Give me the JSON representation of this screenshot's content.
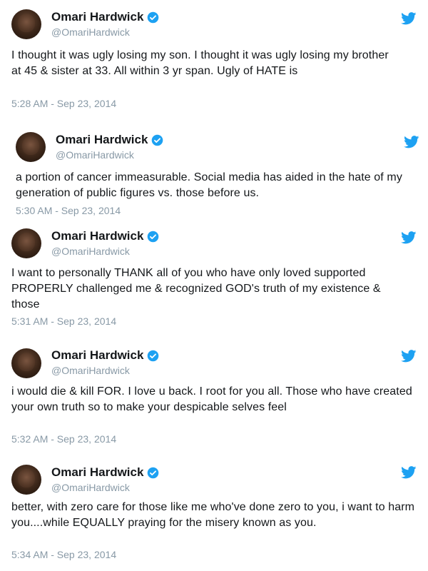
{
  "colors": {
    "twitter_blue": "#1da1f2",
    "text": "#14171a",
    "muted": "#8899a6"
  },
  "tweets": [
    {
      "name": "Omari Hardwick",
      "handle": "@OmariHardwick",
      "text": "I thought it was ugly losing my son. I thought it was ugly losing my brother at 45 & sister at 33. All within 3 yr span. Ugly of HATE is",
      "timestamp": "5:28 AM - Sep 23, 2014",
      "icons": [
        "avatar",
        "verified-badge-icon",
        "twitter-bird-icon"
      ]
    },
    {
      "name": "Omari Hardwick",
      "handle": "@OmariHardwick",
      "text": "a portion of cancer immeasurable. Social media has aided in the hate of my generation of public figures vs. those before us.",
      "timestamp": "5:30 AM - Sep 23, 2014",
      "icons": [
        "avatar",
        "verified-badge-icon",
        "twitter-bird-icon"
      ]
    },
    {
      "name": "Omari Hardwick",
      "handle": "@OmariHardwick",
      "text": "I want to personally THANK all of you who have only loved supported PROPERLY challenged me & recognized GOD's truth of my existence & those",
      "timestamp": "5:31 AM - Sep 23, 2014",
      "icons": [
        "avatar",
        "verified-badge-icon",
        "twitter-bird-icon"
      ]
    },
    {
      "name": "Omari Hardwick",
      "handle": "@OmariHardwick",
      "text": "i would die & kill FOR. I love u back. I root for you all. Those who have created your own truth so to make your despicable selves feel",
      "timestamp": "5:32 AM - Sep 23, 2014",
      "icons": [
        "avatar",
        "verified-badge-icon",
        "twitter-bird-icon"
      ]
    },
    {
      "name": "Omari Hardwick",
      "handle": "@OmariHardwick",
      "text": "better, with zero care for those like me who've done zero to you, i want to harm you....while EQUALLY praying for the misery known as you.",
      "timestamp": "5:34 AM - Sep 23, 2014",
      "icons": [
        "avatar",
        "verified-badge-icon",
        "twitter-bird-icon"
      ]
    }
  ]
}
